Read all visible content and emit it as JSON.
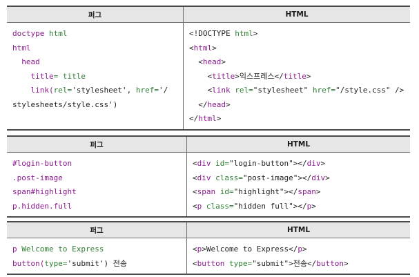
{
  "headers": {
    "pug": "퍼그",
    "html": "HTML"
  },
  "table1": {
    "pug": [
      [
        {
          "t": "doctype ",
          "c": "p"
        },
        {
          "t": "html",
          "c": "g"
        }
      ],
      [
        {
          "t": "html",
          "c": "p"
        }
      ],
      [
        {
          "t": "  head",
          "c": "p"
        }
      ],
      [
        {
          "t": "    title",
          "c": "p"
        },
        {
          "t": "= title",
          "c": "g"
        }
      ],
      [
        {
          "t": "    link(",
          "c": "p"
        },
        {
          "t": "rel=",
          "c": "g"
        },
        {
          "t": "'stylesheet', ",
          "c": "k"
        },
        {
          "t": "href=",
          "c": "g"
        },
        {
          "t": "'/",
          "c": "k"
        }
      ],
      [
        {
          "t": "stylesheets/style.css')",
          "c": "k"
        }
      ]
    ],
    "html": [
      [
        {
          "t": "<!DOCTYPE ",
          "c": "k"
        },
        {
          "t": "html",
          "c": "g"
        },
        {
          "t": ">",
          "c": "k"
        }
      ],
      [
        {
          "t": "<",
          "c": "k"
        },
        {
          "t": "html",
          "c": "p"
        },
        {
          "t": ">",
          "c": "k"
        }
      ],
      [
        {
          "t": "  <",
          "c": "k"
        },
        {
          "t": "head",
          "c": "p"
        },
        {
          "t": ">",
          "c": "k"
        }
      ],
      [
        {
          "t": "    <",
          "c": "k"
        },
        {
          "t": "title",
          "c": "p"
        },
        {
          "t": ">익스프레스</",
          "c": "k"
        },
        {
          "t": "title",
          "c": "p"
        },
        {
          "t": ">",
          "c": "k"
        }
      ],
      [
        {
          "t": "    <",
          "c": "k"
        },
        {
          "t": "link ",
          "c": "p"
        },
        {
          "t": "rel=",
          "c": "g"
        },
        {
          "t": "\"stylesheet\" ",
          "c": "k"
        },
        {
          "t": "href=",
          "c": "g"
        },
        {
          "t": "\"/style.css\" />",
          "c": "k"
        }
      ],
      [
        {
          "t": "  </",
          "c": "k"
        },
        {
          "t": "head",
          "c": "p"
        },
        {
          "t": ">",
          "c": "k"
        }
      ],
      [
        {
          "t": "</",
          "c": "k"
        },
        {
          "t": "html",
          "c": "p"
        },
        {
          "t": ">",
          "c": "k"
        }
      ]
    ]
  },
  "table2": {
    "pug": [
      [
        {
          "t": "#login-button",
          "c": "p"
        }
      ],
      [
        {
          "t": ".post-image",
          "c": "p"
        }
      ],
      [
        {
          "t": "span#highlight",
          "c": "p"
        }
      ],
      [
        {
          "t": "p.hidden.full",
          "c": "p"
        }
      ]
    ],
    "html": [
      [
        {
          "t": "<",
          "c": "k"
        },
        {
          "t": "div ",
          "c": "p"
        },
        {
          "t": "id=",
          "c": "g"
        },
        {
          "t": "\"login-button\"></",
          "c": "k"
        },
        {
          "t": "div",
          "c": "p"
        },
        {
          "t": ">",
          "c": "k"
        }
      ],
      [
        {
          "t": "<",
          "c": "k"
        },
        {
          "t": "div ",
          "c": "p"
        },
        {
          "t": "class=",
          "c": "g"
        },
        {
          "t": "\"post-image\"></",
          "c": "k"
        },
        {
          "t": "div",
          "c": "p"
        },
        {
          "t": ">",
          "c": "k"
        }
      ],
      [
        {
          "t": "<",
          "c": "k"
        },
        {
          "t": "span ",
          "c": "p"
        },
        {
          "t": "id=",
          "c": "g"
        },
        {
          "t": "\"highlight\"></",
          "c": "k"
        },
        {
          "t": "span",
          "c": "p"
        },
        {
          "t": ">",
          "c": "k"
        }
      ],
      [
        {
          "t": "<",
          "c": "k"
        },
        {
          "t": "p ",
          "c": "p"
        },
        {
          "t": "class=",
          "c": "g"
        },
        {
          "t": "\"hidden full\"></",
          "c": "k"
        },
        {
          "t": "p",
          "c": "p"
        },
        {
          "t": ">",
          "c": "k"
        }
      ]
    ]
  },
  "table3": {
    "pug": [
      [
        {
          "t": "p ",
          "c": "p"
        },
        {
          "t": "Welcome to Express",
          "c": "g"
        }
      ],
      [
        {
          "t": "button(",
          "c": "p"
        },
        {
          "t": "type=",
          "c": "g"
        },
        {
          "t": "'submit') ",
          "c": "k"
        },
        {
          "t": "전송",
          "c": "k"
        }
      ]
    ],
    "html": [
      [
        {
          "t": "<",
          "c": "k"
        },
        {
          "t": "p",
          "c": "p"
        },
        {
          "t": ">Welcome to Express</",
          "c": "k"
        },
        {
          "t": "p",
          "c": "p"
        },
        {
          "t": ">",
          "c": "k"
        }
      ],
      [
        {
          "t": "<",
          "c": "k"
        },
        {
          "t": "button ",
          "c": "p"
        },
        {
          "t": "type=",
          "c": "g"
        },
        {
          "t": "\"submit\">전송</",
          "c": "k"
        },
        {
          "t": "button",
          "c": "p"
        },
        {
          "t": ">",
          "c": "k"
        }
      ]
    ]
  }
}
